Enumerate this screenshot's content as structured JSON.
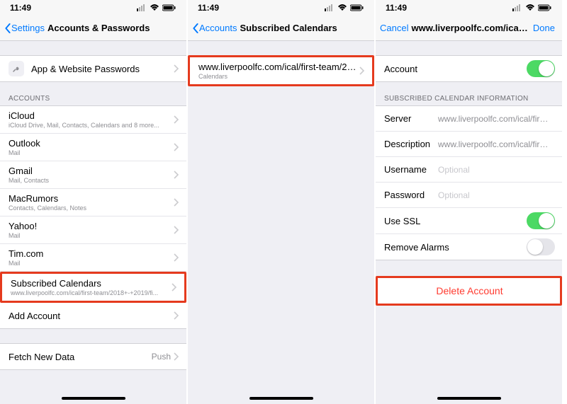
{
  "status": {
    "time": "11:49"
  },
  "panel1": {
    "back": "Settings",
    "title": "Accounts & Passwords",
    "app_web_pw": "App & Website Passwords",
    "accounts_header": "ACCOUNTS",
    "accounts": [
      {
        "title": "iCloud",
        "sub": "iCloud Drive, Mail, Contacts, Calendars and 8 more..."
      },
      {
        "title": "Outlook",
        "sub": "Mail"
      },
      {
        "title": "Gmail",
        "sub": "Mail, Contacts"
      },
      {
        "title": "MacRumors",
        "sub": "Contacts, Calendars, Notes"
      },
      {
        "title": "Yahoo!",
        "sub": "Mail"
      },
      {
        "title": "Tim.com",
        "sub": "Mail"
      },
      {
        "title": "Subscribed Calendars",
        "sub": "www.liverpoolfc.com/ical/first-team/2018+-+2019/fi..."
      }
    ],
    "add_account": "Add Account",
    "fetch": "Fetch New Data",
    "fetch_value": "Push"
  },
  "panel2": {
    "back": "Accounts",
    "title": "Subscribed Calendars",
    "row": {
      "title": "www.liverpoolfc.com/ical/first-team/201...",
      "sub": "Calendars"
    }
  },
  "panel3": {
    "cancel": "Cancel",
    "title": "www.liverpoolfc.com/ical/fi...",
    "done": "Done",
    "account_label": "Account",
    "account_on": true,
    "info_header": "SUBSCRIBED CALENDAR INFORMATION",
    "fields": {
      "server": {
        "label": "Server",
        "value": "www.liverpoolfc.com/ical/first-team/..."
      },
      "description": {
        "label": "Description",
        "value": "www.liverpoolfc.com/ical/first-team/..."
      },
      "username": {
        "label": "Username",
        "placeholder": "Optional"
      },
      "password": {
        "label": "Password",
        "placeholder": "Optional"
      },
      "use_ssl": {
        "label": "Use SSL",
        "on": true
      },
      "remove_alarms": {
        "label": "Remove Alarms",
        "on": false
      }
    },
    "delete": "Delete Account"
  }
}
